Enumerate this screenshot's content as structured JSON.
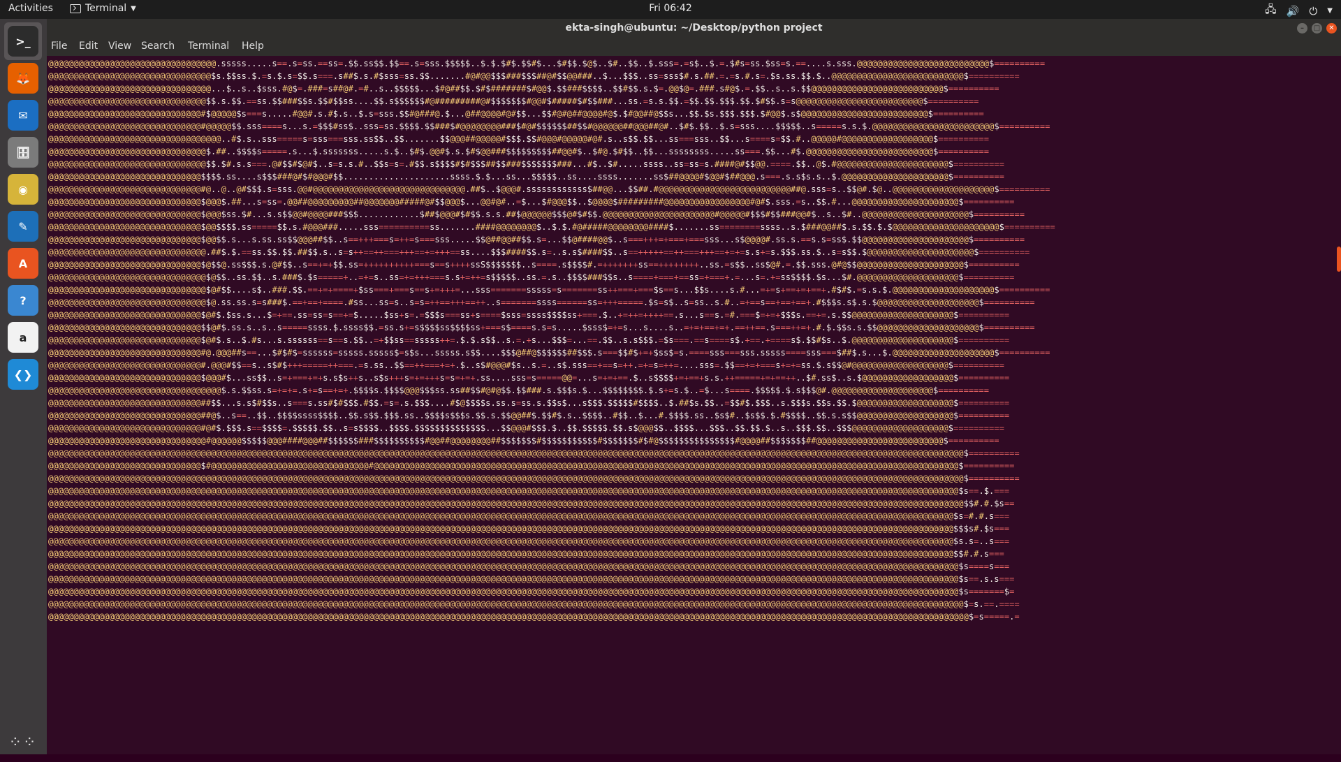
{
  "topbar": {
    "activities": "Activities",
    "app_menu": "Terminal",
    "clock": "Fri 06:42"
  },
  "window": {
    "title": "ekta-singh@ubuntu: ~/Desktop/python project"
  },
  "menu": [
    "File",
    "Edit",
    "View",
    "Search",
    "Terminal",
    "Help"
  ],
  "dock": [
    {
      "name": "terminal",
      "color": "#2c2c2c",
      "active": true
    },
    {
      "name": "firefox",
      "color": "#e66000"
    },
    {
      "name": "thunderbird",
      "color": "#1b6ec2"
    },
    {
      "name": "files",
      "color": "#7b7b7b"
    },
    {
      "name": "rhythmbox",
      "color": "#d6b43a"
    },
    {
      "name": "libreoffice-writer",
      "color": "#1d6fb8"
    },
    {
      "name": "ubuntu-software",
      "color": "#e95420"
    },
    {
      "name": "help",
      "color": "#3a87d1"
    },
    {
      "name": "amazon",
      "color": "#f2f2f2"
    },
    {
      "name": "vscode",
      "color": "#1f8ad6"
    }
  ],
  "terminal": {
    "rows": 45,
    "cols": 242,
    "art_rows": [
      "@@@@@@@@@@@@@@@@@@@@@@@@@@@@@@@@@.sssss.....s==.s=ss.==ss=.$$.ss$$.$$==.s=sss.$$$$$..$.$.$#$.$$#$...$#$$.$@$..$#..$$..$.sss=.=s$..$.=.$#s=ss.$ss=s.==....s.sss.@@@@@@@@@@@@@@@@@@@@@@@@@@$==========",
      "@@@@@@@@@@@@@@@@@@@@@@@@@@@@@@@@$s.$$ss.$.=s.$.s=$$.s===.s##$.s.#$sss=ss.$$.......#@#@@$$$###$$$##@#$$@@###..$...$$$..ss=sss$#.s.##.=.=s.#.s=.$s.ss.$$.$..@@@@@@@@@@@@@@@@@@@@@@@@@@$==========",
      "@@@@@@@@@@@@@@@@@@@@@@@@@@@@@@@@...$..s..$sss.#@$=.###=s##@#.=#..s..$$$$$...$#@##$$.$#$#######$#@@$.$$###$$$$..$$#$$.s.$=.@@$@=.###.s#@$.=.$$..s..s.$$@@@@@@@@@@@@@@@@@@@@@@@@@@$==========",
      "@@@@@@@@@@@@@@@@@@@@@@@@@@@@@@@$$.s.$$.==ss.$$###$$s.$$#$$ss....$$.s$$$$$$#@#########@#$$$$$$$#@@#$#####$#$$###...ss.=s.s.$$.=$$.$$.$$$.$$.$#$$.s=s@@@@@@@@@@@@@@@@@@@@@@@@@$==========",
      "@@@@@@@@@@@@@@@@@@@@@@@@@@@@@@#$@@@@@$s===s.....#@@#.s.#$.s..$.s=sss.$$#@###@.$...@##@@@@#@#$$...$$#@#@##@@@@#@$.$#@@##@$$s...$$.$s.$$$.$$$.$#@@$.s$@@@@@@@@@@@@@@@@@@@@@@@@@$==========",
      "@@@@@@@@@@@@@@@@@@@@@@@@@@@@@@#@@@@@$$.sss====s...s.=$$$#ss$..sss=ss.$$$$.$$###$#@@@@@@@@###$#@#$$$$$$##$$#@@@@@@##@@@##@#..$#$.$$..$.s=sss....$$$$$..s=====s.s.$.@@@@@@@@@@@@@@@@@@@@@@@@$==========",
      "@@@@@@@@@@@@@@@@@@@@@@@@@@@@@@@@@@..#$.s..sss=====s=sss===sss.ss$$..$$.......$$@@@##@@@@@#$$$.$$#@@@#@@@@@#@#.s..s$$.$$...ss===sss..$$...s====s=$$.#..@@@@@#@@@@@@@@@@@@@@@@@@$==========",
      "@@@@@@@@@@@@@@@@@@@@@@@@@@@@@@@$.##..$$$$s=====.s...$.sssssss.....s.$..$#$.@@#$.s.$#$@@###$$$$$$$$$##@@#$..$#@.$#$$..$$...ssssssss.....ss===.$$...#$.@@@@@@@@@@@@@@@@@@@@@@@@@$==========",
      "@@@@@@@@@@@@@@@@@@@@@@@@@@@@@@@$$.$#.s.s===.@#$$#$@#$..s=s.s.#..$$s=s=.#$$.s$$$$#$#$$$##$$###$$$$$$$###...#$..$#.....ssss..ss=ss=s.####@#$$@@.====.$$..@$.#@@@@@@@@@@@@@@@@@@@@@@$==========",
      "@@@@@@@@@@@@@@@@@@@@@@@@@@@@@@$$$$.ss....s$$$###@#$#@@@#$$.....................ssss.$.$...ss...$$$$$..ss....ssss.......ss$##@@@@#$@@#$##@@@.s===.s.s$s.s..$.@@@@@@@@@@@@@@@@@@@@@$==========",
      "@@@@@@@@@@@@@@@@@@@@@@@@@@@@@@#@..@..@#$$$.s=sss.@@#@@@@@@@@@@@@@@@@@@@@@@@@@@@@@@.##$..$@@@#.ssssssssssss$##@@...$$##.#@@@@@@@@@@@@@@@@@@@@@@@@@@##@.sss=s..$$@#.$@..@@@@@@@@@@@@@@@@@@@@$==========",
      "@@@@@@@@@@@@@@@@@@@@@@@@@@@@@@$@@@$.##...s=ss=.@@##@@@@@@@@@##@@@@@@@#####@#$$@@@$...@@#@#..=$...$#@@@$$..$@@@@$#########@@@@@@@@@@@@@@@@@#@#$.sss.=s..$$.#...@@@@@@@@@@@@@@@@@@@@@$==========",
      "@@@@@@@@@@@@@@@@@@@@@@@@@@@@@@$@@@$ss.$#...s.s$$@@#@@@@###$$$............$##$@@@#$#$$.s.s.##$@@@@@@$$$@#$#$$.@@@@@@@@@@@@@@@@@@@@@@#@@@@@#$$$#$$###@@#$..s..$#..@@@@@@@@@@@@@@@@@@@@@$==========",
      "@@@@@@@@@@@@@@@@@@@@@@@@@@@@@@$@@$$$$.ss=====$$.s.#@@@###.....sss==========ss.......####@@@@@@@@$..$.$.#@#####@@@@@@@@####$.......ss========ssss..s.$###@@##$.s.$$.$.$@@@@@@@@@@@@@@@@@@@@@$==========",
      "@@@@@@@@@@@@@@@@@@@@@@@@@@@@@@$@@$$.s...s.ss.ss$$@@@##$$..s==+++===s=++=s===sss.....$$@##@@##$$.s=...$$@####@@$..s===+++=+===+===sss...s$@@@@#.ss.s.==s.s=ss$.$$@@@@@@@@@@@@@@@@@@@@@$==========",
      "@@@@@@@@@@@@@@@@@@@@@@@@@@@@@@@.##$.$.==ss.$$.$$.##$$.s..s=s++==++===+++==+=+++==ss....$$$####$$.s=..s.s$####$$..s==+++++==++===+++==+=+=s.s+=s.$$$.ss.$..s=s$$.$@@@@@@@@@@@@@@@@@@@@@$==========",
      "@@@@@@@@@@@@@@@@@@@@@@@@@@@@@@$@$$@.ss$$$.s.@#$$..s==+=+$$.ss=++++++++++===s==s++++ssS$$$$$$$..s====.s$$$$#.=+++++++ss==++++++++..ss.=s$$..ss$@#.=.$$.sss.@#@$$@@@@@@@@@@@@@@@@@@@@@$==========",
      "@@@@@@@@@@@@@@@@@@@@@@@@@@@@@@@$@$$..ss.$$..s.###$.$s=====+..=+=s..ss=+=+++===s.s+=++=s$$$$$..ss.=.s..$$$$###$$s..s====+===+==ss=+===+.=...s=.+=ss$$$$.$s...$#.@@@@@@@@@@@@@@@@@@@@$==========",
      "@@@@@@@@@@@@@@@@@@@@@@@@@@@@@@@$@#$$....s$..###.$$.==+=+====+$ss===+===s==s+=+++=...sss=======sssss=s=======ss++===+===$s==s...$$s....s.#...=+=s+==+=+==+.#$#$.=s.s.$.@@@@@@@@@@@@@@@@@@@@$==========",
      "@@@@@@@@@@@@@@@@@@@@@@@@@@@@@@@$@.ss.ss.s=s###$.==+==+====.#ss...ss=s..s=s=++==+++==++..s=======ssss======ss=+++=====.$s=s$..s=ss..s.#..=+==s==+==+==+.#$$$s.s$.s.$@@@@@@@@@@@@@@@@@@@@$==========",
      "@@@@@@@@@@@@@@@@@@@@@@@@@@@@@@$@#$.$ss.s...$=+==.ss=ss=s==+=$.....$ss+s=.=$$$s===ss+s====$sss=ssss$$$$ss+===.$..+=++=++++==.s...s==s.=#.===$=+=+$$$s.==+=.s.$$@@@@@@@@@@@@@@@@@@@@$==========",
      "@@@@@@@@@@@@@@@@@@@@@@@@@@@@@@$$@#$.ss.s..s..s=====ssss.$.ssss$$.=ss.s+=s$$$$ss$$$$ss+===s$====s.s=s.....$sss$=+=s...s....s..=+=+==+=+.==++==.s===++=+.#.$.$$s.s.$$@@@@@@@@@@@@@@@@@@@@$==========",
      "@@@@@@@@@@@@@@@@@@@@@@@@@@@@@@$@#$.s..$.#s...s.ssssss==s==s.$$..=+$$ss==sssss++=.$.$.s$$..s.=.+s...$$$=...==.$$..s.s$$$.=$s===.==s====s$.+==.+====s$.$$#$s..$.@@@@@@@@@@@@@@@@@@@@$==========",
      "@@@@@@@@@@@@@@@@@@@@@@@@@@@@@@#@.@@@##s==...$#$#$=ssssss=sssss.sssss$=s$s...sssss.s$$....$$$@##@$$$$$$##$$$.s===$$#$+=+$ss$=s.====sss===sss.sssss====sss===$##$.s...$.@@@@@@@@@@@@@@@@@@@@$==========",
      "@@@@@@@@@@@@@@@@@@@@@@@@@@@@@@#.@@@#$$==s..s$#$+++=====++===.=s.ss..$$==++===+=+.$..s$#@@@#$s..s.=..s$.sss==+==s=++.=+=s=++=....sss=.$$==+=+===s+=+=ss.$.s$$@#@@@@@@@@@@@@@@@@@@@$==========",
      "@@@@@@@@@@@@@@@@@@@@@@@@@@@@@@$@@@#$...ss$$..s=+===+=+s.s$s++s..s$s+++s=+=+++s=s=+=+.ss....sss=s=====@@=...s=+=+==.$..s$$$$+=+==+s.s.++=====+=+==++..$#.ss$..s.$@@@@@@@@@@@@@@@@@@$==========",
      "@@@@@@@@@@@@@@@@@@@@@@@@@@@@@@@@@@$.s.$$ss.s=+=+=.s+=s==+=+.$$$$s.$$$$@@@$$$ss.ss##$$#@#@$$.$$###.s.$$$s.$...$$$$$$$$.$.s+=s.$..=$...s====.$$$$$.$.s$$$@#.@@@@@@@@@@@@@@@@@@@@$==========",
      "@@@@@@@@@@@@@@@@@@@@@@@@@@@@@@##$$...s.s$#$$s..s===s.ss#$#$$$.#$$.=s=.s.$$$....#$@$$$$s.ss.s=ss.s.$$s$...s$$$.$$$$$#$$$$..$.##$s.$$..=$$#$.$$$..s.$$$s.$$s.$$.$@@@@@@@@@@@@@@@@@@@$==========",
      "@@@@@@@@@@@@@@@@@@@@@@@@@@@@@@##@$..s==..$$..$$$$ssss$$$$..$$.s$$.$$$.ss..$$$$s$$$s.$$.s.$$@@##$.$$#$.s..$$$$..#$$..$...#.$$$$.ss..$s$#..$s$$.$.#$$$$..$$.s.s$$@@@@@@@@@@@@@@@@@@@$==========",
      "@@@@@@@@@@@@@@@@@@@@@@@@@@@@@@#@#$.$$$.s==$$$$=.$$$$$.$$..s=s$$$$..$$$$.$$$$$$$$$$$$$$...$$@@@#$$$.$..$$.$$$$$.$$.s$@@@$$..$$$$...$$$..$$.$$.$..s..$$$.$$..$$$@@@@@@@@@@@@@@@@@@@$==========",
      "@@@@@@@@@@@@@@@@@@@@@@@@@@@@@@@#@@@@@@$$$$$@@@####@@@##$$$$$$###$$$$$$$$$$#@@##@@@@@@@@##$$$$$$$#$$$$$$$$$$$#$$$$$$$#$#@$$$$$$$$$$$$$$$#@@@@##$$$$$$$##@@@@@@@@@@@@@@@@@@@@@@@@@$==========",
      "@@@@@@@@@@@@@@@@@@@@@@@@@@@@@@@@@@@@@@@@@@@@@@@@@@@@@@@@@@@@@@@@@@@@@@@@@@@@@@@@@@@@@@@@@@@@@@@@@@@@@@@@@@@@@@@@@@@@@@@@@@@@@@@@@@@@@@@@@@@@@@@@@@@@@@@@@@@@@@@@@@@@@@@@@@@@@@@@@@@@$==========",
      "@@@@@@@@@@@@@@@@@@@@@@@@@@@@@@$#@@@@@@@@@@@@@@@@@@@@@@@@@@@@@@@#@@@@@@@@@@@@@@@@@@@@@@@@@@@@@@@@@@@@@@@@@@@@@@@@@@@@@@@@@@@@@@@@@@@@@@@@@@@@@@@@@@@@@@@@@@@@@@@@@@@@@@@@@@@@@@@@@@@$==========",
      "@@@@@@@@@@@@@@@@@@@@@@@@@@@@@@@@@@@@@@@@@@@@@@@@@@@@@@@@@@@@@@@@@@@@@@@@@@@@@@@@@@@@@@@@@@@@@@@@@@@@@@@@@@@@@@@@@@@@@@@@@@@@@@@@@@@@@@@@@@@@@@@@@@@@@@@@@@@@@@@@@@@@@@@@@@@@@@@@@@@@$==========",
      "@@@@@@@@@@@@@@@@@@@@@@@@@@@@@@@@@@@@@@@@@@@@@@@@@@@@@@@@@@@@@@@@@@@@@@@@@@@@@@@@@@@@@@@@@@@@@@@@@@@@@@@@@@@@@@@@@@@@@@@@@@@@@@@@@@@@@@@@@@@@@@@@@@@@@@@@@@@@@@@@@@@@@@@@@@@@@@@@@@@$s==.$.===",
      "@@@@@@@@@@@@@@@@@@@@@@@@@@@@@@@@@@@@@@@@@@@@@@@@@@@@@@@@@@@@@@@@@@@@@@@@@@@@@@@@@@@@@@@@@@@@@@@@@@@@@@@@@@@@@@@@@@@@@@@@@@@@@@@@@@@@@@@@@@@@@@@@@@@@@@@@@@@@@@@@@@@@@@@@@@@@@@@@@@@@$$#.#.$s==",
      "@@@@@@@@@@@@@@@@@@@@@@@@@@@@@@@@@@@@@@@@@@@@@@@@@@@@@@@@@@@@@@@@@@@@@@@@@@@@@@@@@@@@@@@@@@@@@@@@@@@@@@@@@@@@@@@@@@@@@@@@@@@@@@@@@@@@@@@@@@@@@@@@@@@@@@@@@@@@@@@@@@@@@@@@@@@@@@@@@@$s=#.#.s===",
      "@@@@@@@@@@@@@@@@@@@@@@@@@@@@@@@@@@@@@@@@@@@@@@@@@@@@@@@@@@@@@@@@@@@@@@@@@@@@@@@@@@@@@@@@@@@@@@@@@@@@@@@@@@@@@@@@@@@@@@@@@@@@@@@@@@@@@@@@@@@@@@@@@@@@@@@@@@@@@@@@@@@@@@@@@@@@@@@@@@$$$s#.$s===",
      "@@@@@@@@@@@@@@@@@@@@@@@@@@@@@@@@@@@@@@@@@@@@@@@@@@@@@@@@@@@@@@@@@@@@@@@@@@@@@@@@@@@@@@@@@@@@@@@@@@@@@@@@@@@@@@@@@@@@@@@@@@@@@@@@@@@@@@@@@@@@@@@@@@@@@@@@@@@@@@@@@@@@@@@@@@@@@@@@@@$s.s=..s===",
      "@@@@@@@@@@@@@@@@@@@@@@@@@@@@@@@@@@@@@@@@@@@@@@@@@@@@@@@@@@@@@@@@@@@@@@@@@@@@@@@@@@@@@@@@@@@@@@@@@@@@@@@@@@@@@@@@@@@@@@@@@@@@@@@@@@@@@@@@@@@@@@@@@@@@@@@@@@@@@@@@@@@@@@@@@@@@@@@@@@$$#.#.s===",
      "@@@@@@@@@@@@@@@@@@@@@@@@@@@@@@@@@@@@@@@@@@@@@@@@@@@@@@@@@@@@@@@@@@@@@@@@@@@@@@@@@@@@@@@@@@@@@@@@@@@@@@@@@@@@@@@@@@@@@@@@@@@@@@@@@@@@@@@@@@@@@@@@@@@@@@@@@@@@@@@@@@@@@@@@@@@@@@@@@@@$s====s===",
      "@@@@@@@@@@@@@@@@@@@@@@@@@@@@@@@@@@@@@@@@@@@@@@@@@@@@@@@@@@@@@@@@@@@@@@@@@@@@@@@@@@@@@@@@@@@@@@@@@@@@@@@@@@@@@@@@@@@@@@@@@@@@@@@@@@@@@@@@@@@@@@@@@@@@@@@@@@@@@@@@@@@@@@@@@@@@@@@@@@@$s==.s.s===",
      "@@@@@@@@@@@@@@@@@@@@@@@@@@@@@@@@@@@@@@@@@@@@@@@@@@@@@@@@@@@@@@@@@@@@@@@@@@@@@@@@@@@@@@@@@@@@@@@@@@@@@@@@@@@@@@@@@@@@@@@@@@@@@@@@@@@@@@@@@@@@@@@@@@@@@@@@@@@@@@@@@@@@@@@@@@@@@@@@@@@$s=======$=",
      "@@@@@@@@@@@@@@@@@@@@@@@@@@@@@@@@@@@@@@@@@@@@@@@@@@@@@@@@@@@@@@@@@@@@@@@@@@@@@@@@@@@@@@@@@@@@@@@@@@@@@@@@@@@@@@@@@@@@@@@@@@@@@@@@@@@@@@@@@@@@@@@@@@@@@@@@@@@@@@@@@@@@@@@@@@@@@@@@@@@@$=s.==.====",
      "@@@@@@@@@@@@@@@@@@@@@@@@@@@@@@@@@@@@@@@@@@@@@@@@@@@@@@@@@@@@@@@@@@@@@@@@@@@@@@@@@@@@@@@@@@@@@@@@@@@@@@@@@@@@@@@@@@@@@@@@@@@@@@@@@@@@@@@@@@@@@@@@@@@@@@@@@@@@@@@@@@@@@@@@@@@@@@@@@@@@@$=s=====.="
    ]
  }
}
